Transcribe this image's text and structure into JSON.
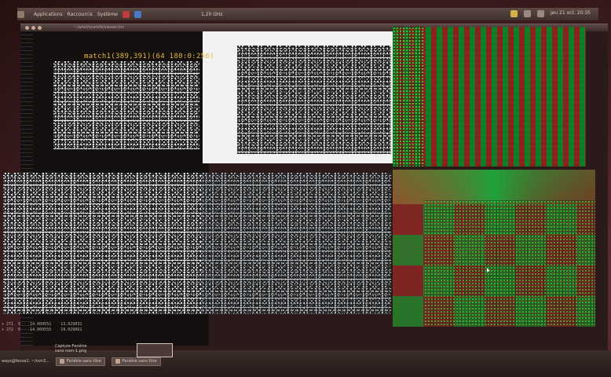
{
  "panel": {
    "menu": [
      "Applications",
      "Raccourcis",
      "Système"
    ],
    "cpu_freq": "1,20 GHz",
    "clock": "jeu 21 oct. 20:35"
  },
  "window": {
    "path": "~/ariel/ocamlb/viewer/src"
  },
  "caption": "match1(389,391)(64 180:0:256)",
  "terminal_lines": [
    "+ 271  0    14.009551    13.029031",
    "+ 272  0    14.009555    19.029661"
  ],
  "popup": {
    "title": "Capture-Fenêtre",
    "file": "sans nom-1.png"
  },
  "taskbar": {
    "left_label": "ways@fecoa1: ~/ovn3...",
    "task1": "Fenêtre sans titre",
    "task2": "Fenêtre sans titre"
  }
}
